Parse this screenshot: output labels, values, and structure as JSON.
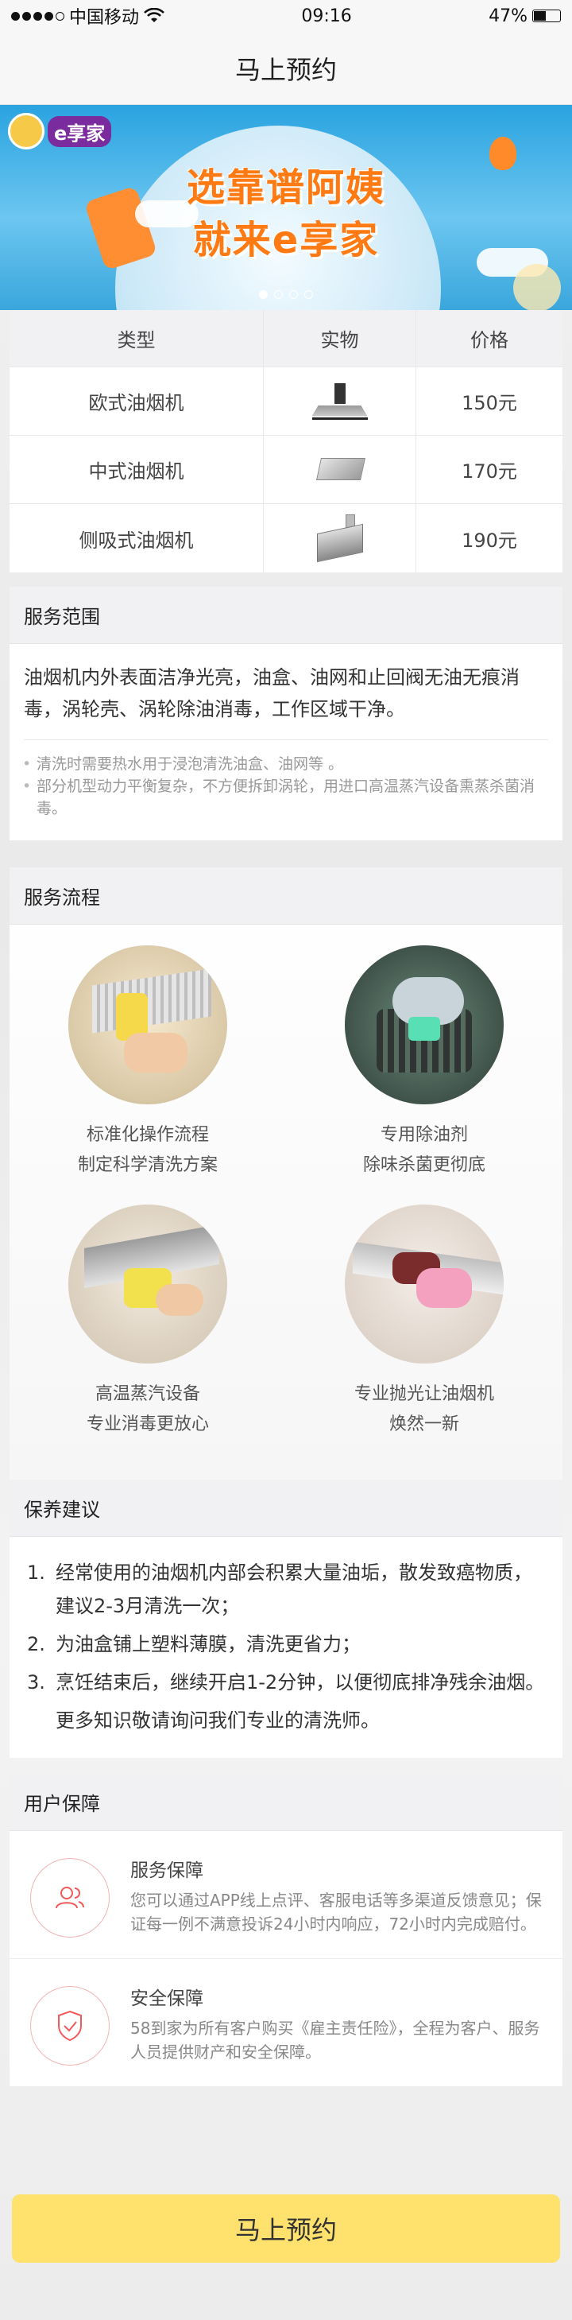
{
  "status_bar": {
    "carrier": "中国移动",
    "time": "09:16",
    "battery": "47%",
    "battery_level": 0.47,
    "signal_bars": 4
  },
  "nav": {
    "title": "马上预约"
  },
  "banner": {
    "logo_text": "e享家",
    "slogan_line1": "选靠谱阿姨",
    "slogan_line2": "就来e享家",
    "pages": 4,
    "active_page": 1
  },
  "price_table": {
    "headers": [
      "类型",
      "实物",
      "价格"
    ],
    "rows": [
      {
        "type": "欧式油烟机",
        "image_icon": "euro-range-hood-icon",
        "price": "150元"
      },
      {
        "type": "中式油烟机",
        "image_icon": "chinese-range-hood-icon",
        "price": "170元"
      },
      {
        "type": "侧吸式油烟机",
        "image_icon": "side-suction-range-hood-icon",
        "price": "190元"
      }
    ]
  },
  "service_scope": {
    "title": "服务范围",
    "main": "油烟机内外表面洁净光亮，油盒、油网和止回阀无油无痕消毒，涡轮壳、涡轮除油消毒，工作区域干净。",
    "notes": [
      "清洗时需要热水用于浸泡清洗油盒、油网等 。",
      "部分机型动力平衡复杂，不方便拆卸涡轮，用进口高温蒸汽设备熏蒸杀菌消毒。"
    ]
  },
  "process": {
    "title": "服务流程",
    "steps": [
      {
        "line1": "标准化操作流程",
        "line2": "制定科学清洗方案"
      },
      {
        "line1": "专用除油剂",
        "line2": "除味杀菌更彻底"
      },
      {
        "line1": "高温蒸汽设备",
        "line2": "专业消毒更放心"
      },
      {
        "line1": "专业抛光让油烟机",
        "line2": "焕然一新"
      }
    ]
  },
  "suggestions": {
    "title": "保养建议",
    "items": [
      {
        "num": "1.",
        "text": "经常使用的油烟机内部会积累大量油垢，散发致癌物质，建议2-3月清洗一次；"
      },
      {
        "num": "2.",
        "text": "为油盒铺上塑料薄膜，清洗更省力；"
      },
      {
        "num": "3.",
        "text": "烹饪结束后，继续开启1-2分钟，以便彻底排净残余油烟。"
      }
    ],
    "more": "更多知识敬请询问我们专业的清洗师。"
  },
  "guarantee": {
    "title": "用户保障",
    "items": [
      {
        "icon": "users-icon",
        "title": "服务保障",
        "text": "您可以通过APP线上点评、客服电话等多渠道反馈意见；保证每一例不满意投诉24小时内响应，72小时内完成赔付。"
      },
      {
        "icon": "shield-check-icon",
        "title": "安全保障",
        "text": "58到家为所有客户购买《雇主责任险》，全程为客户、服务人员提供财产和安全保障。"
      }
    ]
  },
  "cta": {
    "label": "马上预约"
  },
  "colors": {
    "accent": "#ffe16e",
    "slogan": "#ff7a12",
    "icon_stroke": "#f05a5a"
  }
}
